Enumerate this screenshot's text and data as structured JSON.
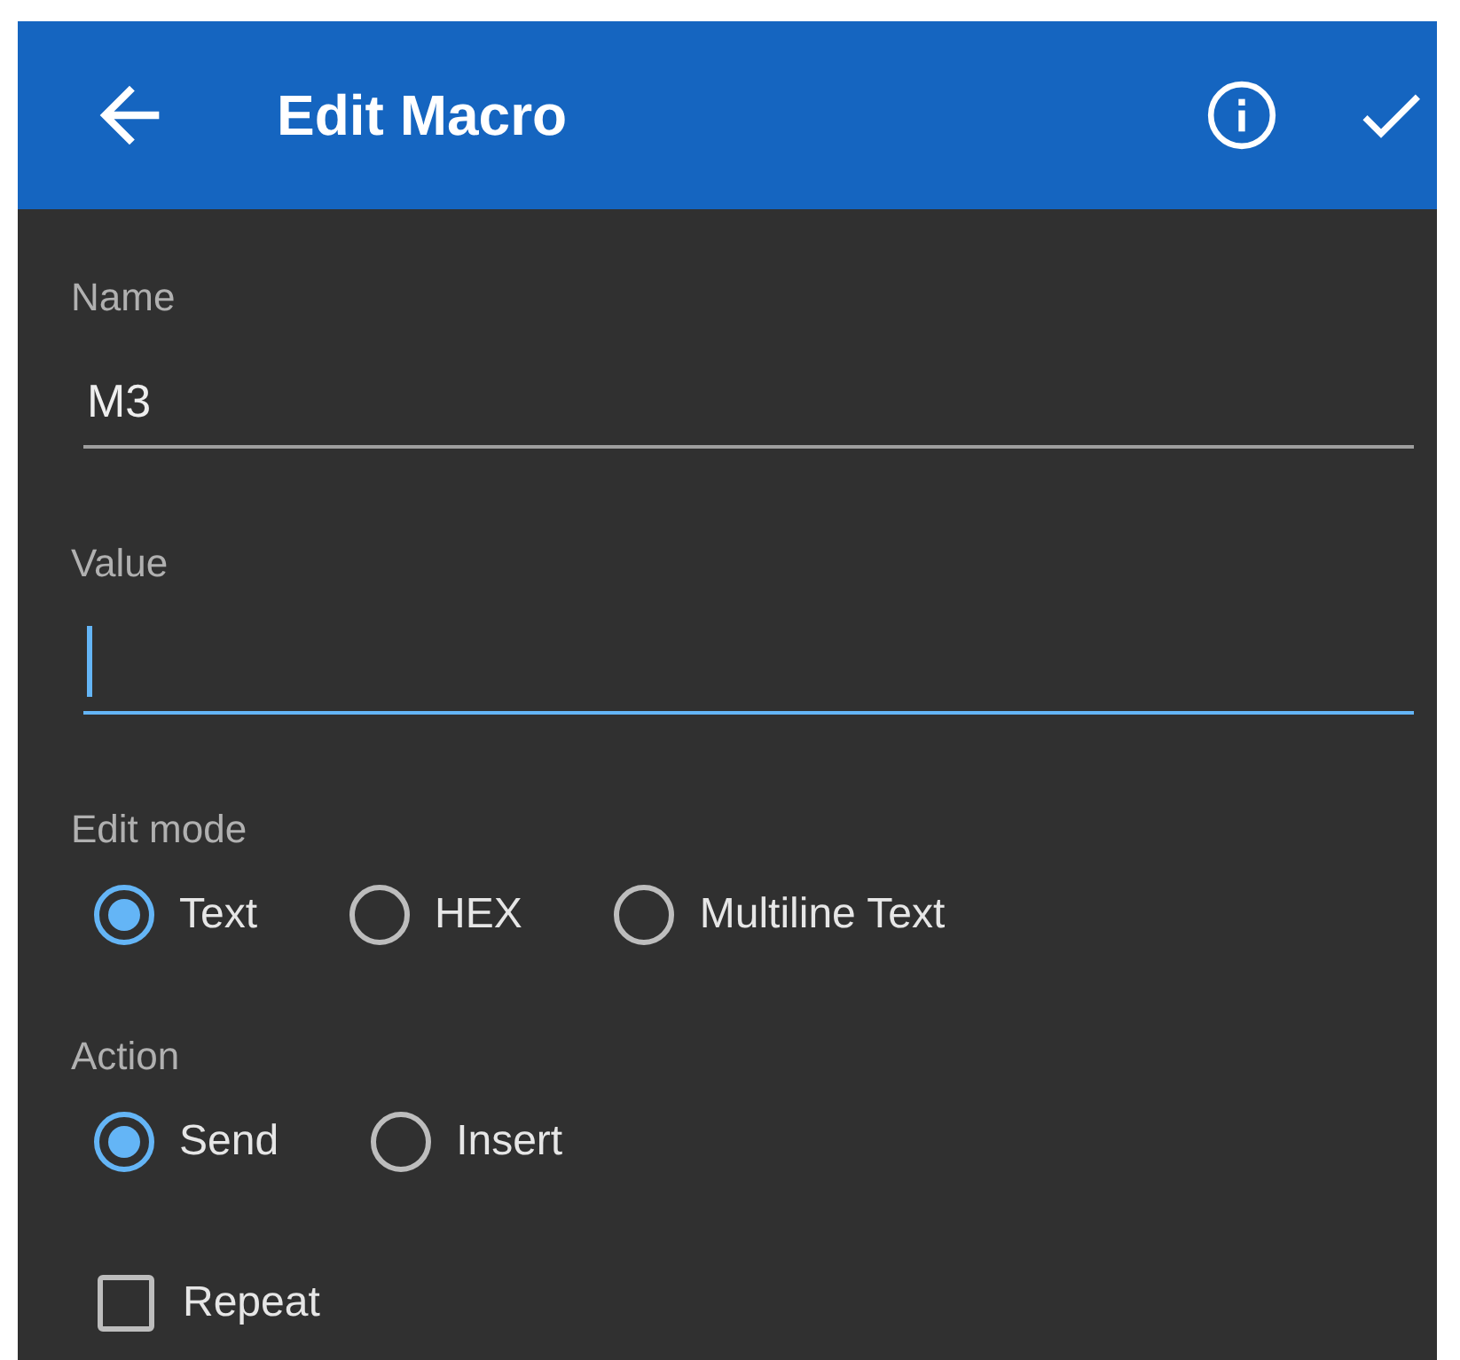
{
  "header": {
    "title": "Edit Macro"
  },
  "name_field": {
    "label": "Name",
    "value": "M3",
    "focused": false
  },
  "value_field": {
    "label": "Value",
    "focused": true
  },
  "edit_mode": {
    "label": "Edit mode",
    "options": [
      {
        "label": "Text",
        "selected": true
      },
      {
        "label": "HEX",
        "selected": false
      },
      {
        "label": "Multiline Text",
        "selected": false
      }
    ]
  },
  "action": {
    "label": "Action",
    "options": [
      {
        "label": "Send",
        "selected": true
      },
      {
        "label": "Insert",
        "selected": false
      }
    ]
  },
  "repeat": {
    "label": "Repeat",
    "checked": false
  }
}
